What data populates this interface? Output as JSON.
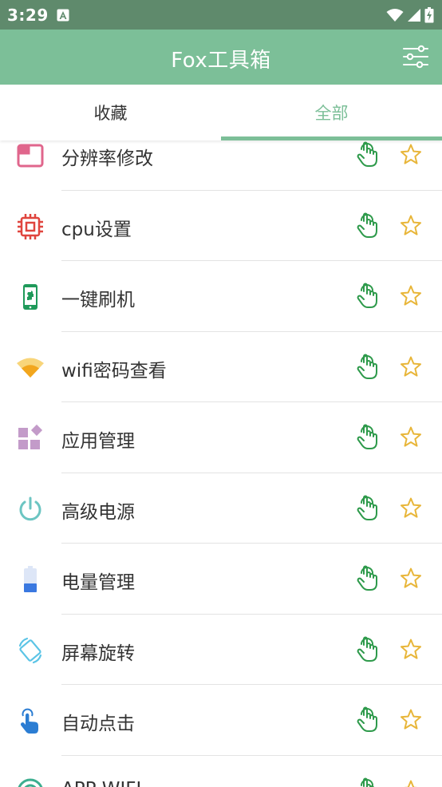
{
  "status_bar": {
    "time": "3:29"
  },
  "app_bar": {
    "title": "Fox工具箱"
  },
  "tabs": [
    {
      "label": "收藏",
      "selected": false
    },
    {
      "label": "全部",
      "selected": true
    }
  ],
  "accent_color": "#7cbf98",
  "tools": [
    {
      "label": "分辨率修改",
      "icon": "resolution-icon"
    },
    {
      "label": "cpu设置",
      "icon": "cpu-icon"
    },
    {
      "label": "一键刷机",
      "icon": "phone-flash-icon"
    },
    {
      "label": "wifi密码查看",
      "icon": "wifi-icon"
    },
    {
      "label": "应用管理",
      "icon": "apps-icon"
    },
    {
      "label": "高级电源",
      "icon": "power-icon"
    },
    {
      "label": "电量管理",
      "icon": "battery-icon"
    },
    {
      "label": "屏幕旋转",
      "icon": "screen-rotation-icon"
    },
    {
      "label": "自动点击",
      "icon": "touch-icon"
    },
    {
      "label": "APP WIFI",
      "icon": "app-wifi-icon"
    }
  ]
}
